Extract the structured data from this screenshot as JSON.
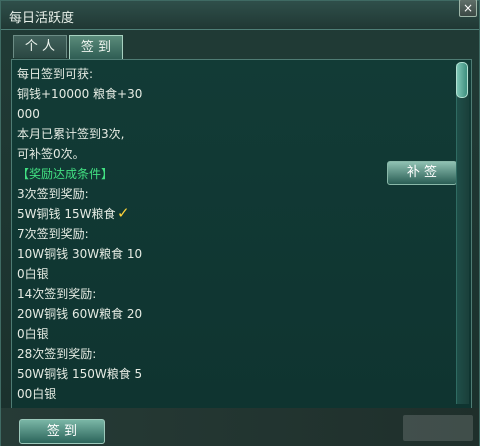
{
  "window": {
    "title": "每日活跃度",
    "close_label": "×"
  },
  "tabs": [
    {
      "label": "个 人",
      "active": false
    },
    {
      "label": "签 到",
      "active": true
    }
  ],
  "content": {
    "lines": [
      "每日签到可获:",
      " 铜钱+10000 粮食+30",
      "000",
      "本月已累计签到3次,",
      "可补签0次。",
      "",
      "【奖励达成条件】",
      "3次签到奖励:",
      "5W铜钱 15W粮食",
      "7次签到奖励:",
      "10W铜钱 30W粮食 10",
      "0白银",
      "14次签到奖励:",
      "20W铜钱 60W粮食 20",
      "0白银",
      "28次签到奖励:",
      "50W铜钱 150W粮食 5",
      "00白银"
    ]
  },
  "buttons": {
    "buqian": "补 签",
    "qiandao": "签 到"
  },
  "icons": {
    "check_symbol": "✓"
  },
  "colors": {
    "highlight_green": "#42e082",
    "check_yellow": "#ffd33a"
  }
}
